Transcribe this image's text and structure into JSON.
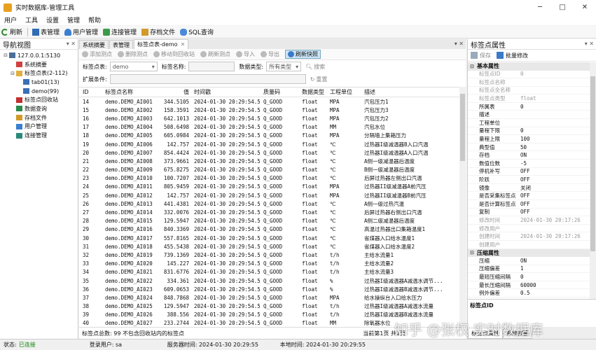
{
  "window": {
    "title": "实时数据库-管理工具"
  },
  "menu": [
    "用户",
    "工具",
    "设置",
    "管理",
    "帮助"
  ],
  "toolbar": [
    "刷新",
    "表管理",
    "用户管理",
    "连接管理",
    "存档文件",
    "SQL查询"
  ],
  "nav": {
    "title": "导航视图",
    "items": [
      {
        "label": "127.0.0.1:5130",
        "level": 0,
        "exp": "⊟",
        "icon": "server-icon"
      },
      {
        "label": "系统摘要",
        "level": 1,
        "exp": "",
        "icon": "summary-icon"
      },
      {
        "label": "标签点表(2-112)",
        "level": 1,
        "exp": "⊟",
        "icon": "folder-icon"
      },
      {
        "label": "tab01(13)",
        "level": 2,
        "exp": "",
        "icon": "table-icon"
      },
      {
        "label": "demo(99)",
        "level": 2,
        "exp": "",
        "icon": "table-icon"
      },
      {
        "label": "标签点回收站",
        "level": 1,
        "exp": "",
        "icon": "recycle-icon"
      },
      {
        "label": "数据查询",
        "level": 1,
        "exp": "",
        "icon": "query-icon"
      },
      {
        "label": "存档文件",
        "level": 1,
        "exp": "",
        "icon": "archive-icon"
      },
      {
        "label": "用户管理",
        "level": 1,
        "exp": "",
        "icon": "user-icon"
      },
      {
        "label": "连接管理",
        "level": 1,
        "exp": "",
        "icon": "connection-icon"
      }
    ]
  },
  "tabs": [
    {
      "label": "系统摘要",
      "active": false
    },
    {
      "label": "表管理",
      "active": false
    },
    {
      "label": "标签点表-demo",
      "active": true
    }
  ],
  "subtoolbar": [
    {
      "label": "添加测点",
      "state": "disabled",
      "icon": "add-icon"
    },
    {
      "label": "删除测点",
      "state": "disabled",
      "icon": "delete-icon"
    },
    {
      "label": "移动到回收站",
      "state": "disabled",
      "icon": "recycle-icon"
    },
    {
      "label": "刷新测点",
      "state": "disabled",
      "icon": "refresh-icon"
    },
    {
      "label": "导入",
      "state": "disabled",
      "icon": "import-icon"
    },
    {
      "label": "导出",
      "state": "disabled",
      "icon": "export-icon"
    },
    {
      "label": "刷新快照",
      "state": "highlight",
      "icon": "snapshot-icon"
    }
  ],
  "filter": {
    "table_label": "标签点表:",
    "table_value": "demo",
    "name_label": "标签名称:",
    "name_value": "",
    "type_label": "数据类型:",
    "type_value": "所有类型",
    "search": "搜索",
    "ext_label": "扩展条件:",
    "ext_value": "",
    "reset": "重置"
  },
  "grid": {
    "headers": [
      "ID",
      "标签点名称",
      "值",
      "时间戳",
      "质量码",
      "数据类型",
      "工程单位",
      "描述"
    ],
    "rows": [
      [
        "14",
        "demo.DEMO_AI001",
        "344.5105",
        "2024-01-30 20:29:54.501",
        "Q_GOOD",
        "float",
        "MPA",
        "汽包压力1"
      ],
      [
        "15",
        "demo.DEMO_AI002",
        "158.3591",
        "2024-01-30 20:29:54.501",
        "Q_GOOD",
        "float",
        "MPA",
        "汽包压力3"
      ],
      [
        "16",
        "demo.DEMO_AI003",
        "642.1013",
        "2024-01-30 20:29:54.501",
        "Q_GOOD",
        "float",
        "MPA",
        "汽包压力2"
      ],
      [
        "17",
        "demo.DEMO_AI004",
        "508.6498",
        "2024-01-30 20:29:54.501",
        "Q_GOOD",
        "float",
        "MM",
        "汽包水位"
      ],
      [
        "18",
        "demo.DEMO_AI005",
        "605.0984",
        "2024-01-30 20:29:54.501",
        "Q_GOOD",
        "float",
        "MPA",
        "分隔墙上集箱压力"
      ],
      [
        "19",
        "demo.DEMO_AI006",
        "142.757",
        "2024-01-30 20:29:54.501",
        "Q_GOOD",
        "float",
        "℃",
        "过热器I级减温器B入口汽温"
      ],
      [
        "20",
        "demo.DEMO_AI007",
        "854.4424",
        "2024-01-30 20:29:54.501",
        "Q_GOOD",
        "float",
        "℃",
        "过热器I级减温器A入口汽温"
      ],
      [
        "21",
        "demo.DEMO_AI008",
        "373.9661",
        "2024-01-30 20:29:54.501",
        "Q_GOOD",
        "float",
        "℃",
        "A侧一级减温器后温度"
      ],
      [
        "22",
        "demo.DEMO_AI009",
        "675.8275",
        "2024-01-30 20:29:54.501",
        "Q_GOOD",
        "float",
        "℃",
        "B侧一级减温器后温度"
      ],
      [
        "23",
        "demo.DEMO_AI010",
        "100.7207",
        "2024-01-30 20:29:54.501",
        "Q_GOOD",
        "float",
        "℃",
        "后屏过热器左侧出口汽温"
      ],
      [
        "24",
        "demo.DEMO_AI011",
        "805.9459",
        "2024-01-30 20:29:54.501",
        "Q_GOOD",
        "float",
        "MPA",
        "过热器II级减温器A前汽压"
      ],
      [
        "25",
        "demo.DEMO_AI012",
        "142.757",
        "2024-01-30 20:29:54.501",
        "Q_GOOD",
        "float",
        "MPA",
        "过热器II级减温器B前汽压"
      ],
      [
        "26",
        "demo.DEMO_AI013",
        "441.4381",
        "2024-01-30 20:29:54.501",
        "Q_GOOD",
        "float",
        "℃",
        "A侧一级过热汽温"
      ],
      [
        "27",
        "demo.DEMO_AI014",
        "332.0076",
        "2024-01-30 20:29:54.501",
        "Q_GOOD",
        "float",
        "℃",
        "后屏过热器右侧出口汽温"
      ],
      [
        "28",
        "demo.DEMO_AI015",
        "129.5947",
        "2024-01-30 20:29:54.501",
        "Q_GOOD",
        "float",
        "℃",
        "A侧二级减温器后温度"
      ],
      [
        "29",
        "demo.DEMO_AI016",
        "840.3369",
        "2024-01-30 20:29:54.501",
        "Q_GOOD",
        "float",
        "℃",
        "高温过热器出口集箱温度1"
      ],
      [
        "30",
        "demo.DEMO_AI017",
        "557.8165",
        "2024-01-30 20:29:54.501",
        "Q_GOOD",
        "float",
        "℃",
        "省煤器入口给水温度1"
      ],
      [
        "31",
        "demo.DEMO_AI018",
        "455.5438",
        "2024-01-30 20:29:54.501",
        "Q_GOOD",
        "float",
        "℃",
        "省煤器入口给水温度2"
      ],
      [
        "32",
        "demo.DEMO_AI019",
        "739.1369",
        "2024-01-30 20:29:54.501",
        "Q_GOOD",
        "float",
        "t/h",
        "主给水流量1"
      ],
      [
        "33",
        "demo.DEMO_AI020",
        "145.227",
        "2024-01-30 20:29:54.501",
        "Q_GOOD",
        "float",
        "t/h",
        "主给水流量2"
      ],
      [
        "34",
        "demo.DEMO_AI021",
        "831.6776",
        "2024-01-30 20:29:54.501",
        "Q_GOOD",
        "float",
        "t/h",
        "主给水流量3"
      ],
      [
        "35",
        "demo.DEMO_AI022",
        "334.361",
        "2024-01-30 20:29:54.501",
        "Q_GOOD",
        "float",
        "%",
        "过热器I级减温器A减温水调节..."
      ],
      [
        "36",
        "demo.DEMO_AI023",
        "609.0653",
        "2024-01-30 20:29:54.501",
        "Q_GOOD",
        "float",
        "%",
        "过热器I级减温器B减温水调节..."
      ],
      [
        "37",
        "demo.DEMO_AI024",
        "848.7868",
        "2024-01-30 20:29:54.501",
        "Q_GOOD",
        "float",
        "MPA",
        "给水操纵台入口给水压力"
      ],
      [
        "38",
        "demo.DEMO_AI025",
        "129.5947",
        "2024-01-30 20:29:54.501",
        "Q_GOOD",
        "float",
        "t/h",
        "过热器I级减温器A减温水流量"
      ],
      [
        "39",
        "demo.DEMO_AI026",
        "388.556",
        "2024-01-30 20:29:54.501",
        "Q_GOOD",
        "float",
        "t/h",
        "过热器I级减温器B减温水流量"
      ],
      [
        "40",
        "demo.DEMO_AI027",
        "233.2744",
        "2024-01-30 20:29:54.501",
        "Q_GOOD",
        "float",
        "MM",
        "除氧器水位"
      ],
      [
        "41",
        "demo.DEMO_AI028",
        "878.0745",
        "2024-01-30 20:29:54.501",
        "Q_GOOD",
        "float",
        "t/h",
        "过热器II级减温器A减温水调..."
      ],
      [
        "42",
        "demo.DEMO_AI029",
        "788.3996",
        "2024-01-30 20:29:54.501",
        "Q_GOOD",
        "float",
        "t/h",
        "过热器II级减温器B减温水调..."
      ],
      [
        "43",
        "demo.DEMO_AI030",
        "220.3346",
        "2024-01-30 20:29:54.501",
        "Q_GOOD",
        "float",
        "t/h",
        "过热器II级减温器A减温水流量"
      ]
    ]
  },
  "grid_status": {
    "total": "标签点总数: 99 不包含回收站内的标签点",
    "page": "当前第1页 共1页"
  },
  "props": {
    "title": "标签点属性",
    "save": "保存",
    "batch": "批量修改",
    "groups": [
      {
        "label": "基本属性",
        "rows": [
          {
            "k": "标签点ID",
            "v": "0",
            "gray": true
          },
          {
            "k": "标签点名称",
            "v": "",
            "gray": true
          },
          {
            "k": "标签点全名称",
            "v": "",
            "gray": true
          },
          {
            "k": "标签点类型",
            "v": "float",
            "gray": true
          },
          {
            "k": "所属表",
            "v": "0",
            "gray": false
          },
          {
            "k": "描述",
            "v": "",
            "gray": false
          },
          {
            "k": "工程单位",
            "v": "",
            "gray": false
          },
          {
            "k": "量程下限",
            "v": "0",
            "gray": false
          },
          {
            "k": "量程上限",
            "v": "100",
            "gray": false
          },
          {
            "k": "典型值",
            "v": "50",
            "gray": false
          },
          {
            "k": "存档",
            "v": "ON",
            "gray": false
          },
          {
            "k": "数值位数",
            "v": "-5",
            "gray": false
          },
          {
            "k": "停机补写",
            "v": "OFF",
            "gray": false
          },
          {
            "k": "阶跃",
            "v": "OFF",
            "gray": false
          },
          {
            "k": "镜像",
            "v": "关闭",
            "gray": false
          },
          {
            "k": "是否采集标签点",
            "v": "OFF",
            "gray": false
          },
          {
            "k": "是否计算标签点",
            "v": "OFF",
            "gray": false
          },
          {
            "k": "复制",
            "v": "OFF",
            "gray": false
          },
          {
            "k": "修改时间",
            "v": "2024-01-30 20:17:26",
            "gray": true
          },
          {
            "k": "修改用户",
            "v": "",
            "gray": true
          },
          {
            "k": "创建时间",
            "v": "2024-01-30 20:17:26",
            "gray": true
          },
          {
            "k": "创建用户",
            "v": "",
            "gray": true
          }
        ]
      },
      {
        "label": "压缩属性",
        "rows": [
          {
            "k": "压缩",
            "v": "ON",
            "gray": false
          },
          {
            "k": "压缩偏差",
            "v": "1",
            "gray": false
          },
          {
            "k": "最短压缩间隔",
            "v": "0",
            "gray": false
          },
          {
            "k": "最长压缩间隔",
            "v": "60000",
            "gray": false
          },
          {
            "k": "例外偏差",
            "v": "0.5",
            "gray": false
          }
        ]
      }
    ],
    "desc_title": "标签点ID",
    "bottom_tabs": [
      {
        "label": "标签点属性",
        "active": true
      },
      {
        "label": "系统摘要",
        "active": false
      }
    ]
  },
  "status": {
    "state_label": "状态:",
    "state_value": "已连接",
    "login": "登录用户: sa",
    "server_time": "服务器时间: 2024-01-30 20:29:55",
    "local_time": "本地时间: 2024-01-30 20:29:55"
  },
  "watermark": "知乎 @张权 实时数据库",
  "colors": {
    "accent": "#1f6fbf",
    "ok": "#118811",
    "highlight": "#cce4f7"
  }
}
